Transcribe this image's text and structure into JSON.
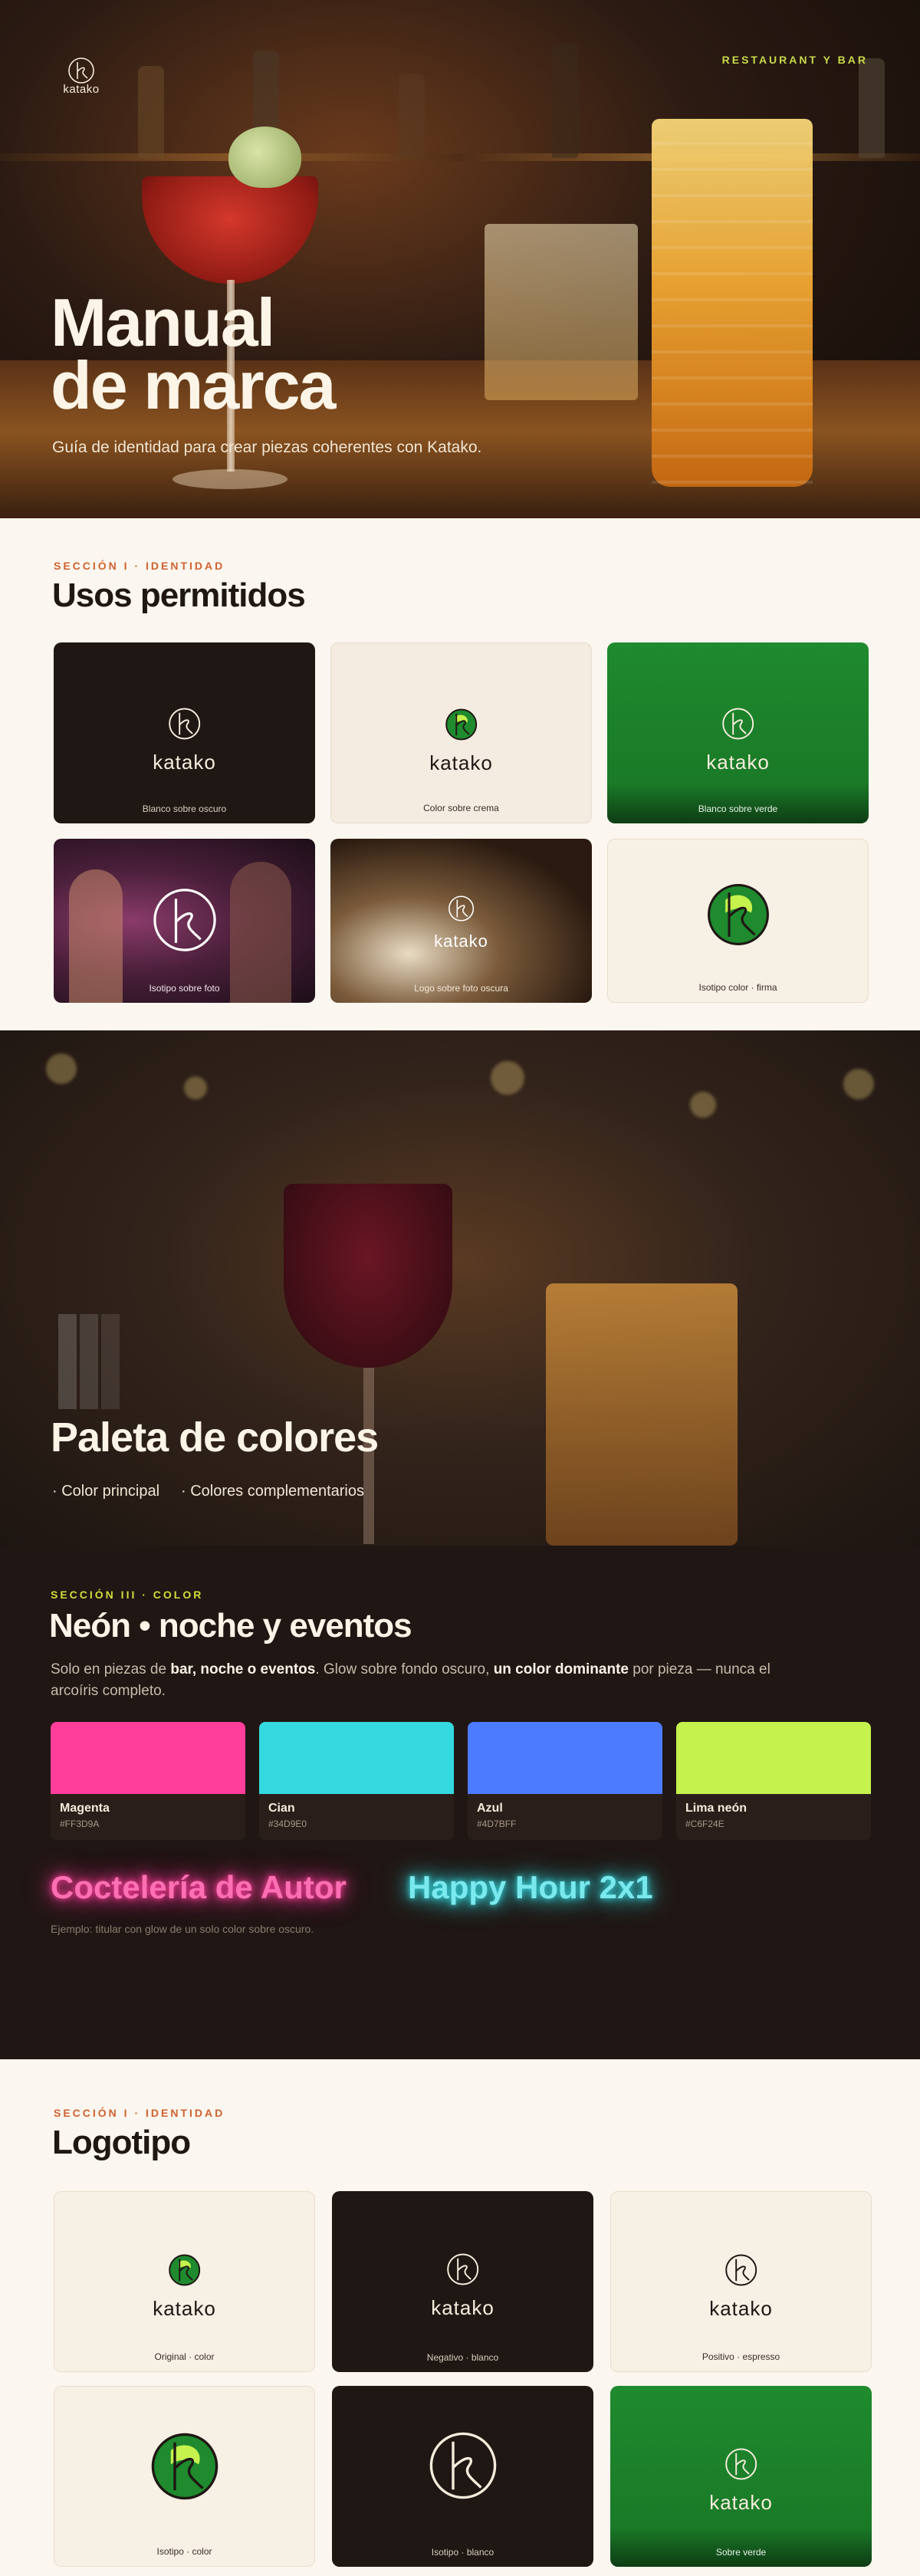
{
  "hero": {
    "brand": "katako",
    "tagline": "RESTAURANT Y BAR",
    "title_line1": "Manual",
    "title_line2": "de marca",
    "subtitle": "Guía de identidad para crear piezas coherentes con Katako."
  },
  "usos": {
    "eyebrow": "SECCIÓN I · IDENTIDAD",
    "title": "Usos permitidos",
    "cards": [
      {
        "caption": "Blanco sobre oscuro",
        "word": "katako"
      },
      {
        "caption": "Color sobre crema",
        "word": "katako"
      },
      {
        "caption": "Blanco sobre verde",
        "word": "katako"
      },
      {
        "caption": "Isotipo sobre foto"
      },
      {
        "caption": "Logo sobre foto oscura",
        "word": "katako"
      },
      {
        "caption": "Isotipo color · firma"
      }
    ]
  },
  "paleta": {
    "title": "Paleta de colores",
    "items": [
      "Color principal",
      "Colores complementarios"
    ]
  },
  "neon": {
    "eyebrow": "SECCIÓN III · COLOR",
    "title": "Neón • noche y eventos",
    "desc_pre": "Solo en piezas de ",
    "desc_bold1": "bar, noche o eventos",
    "desc_mid": ". Glow sobre fondo oscuro, ",
    "desc_bold2": "un color dominante",
    "desc_post": " por pieza — nunca el arcoíris completo.",
    "swatches": [
      {
        "name": "Magenta",
        "hex": "#FF3D9A",
        "color": "#FF3D9A"
      },
      {
        "name": "Cian",
        "hex": "#34D9E0",
        "color": "#34D9E0"
      },
      {
        "name": "Azul",
        "hex": "#4D7BFF",
        "color": "#4D7BFF"
      },
      {
        "name": "Lima neón",
        "hex": "#C6F24E",
        "color": "#C6F24E"
      }
    ],
    "sample1": "Coctelería de Autor",
    "sample2": "Happy Hour 2x1",
    "example": "Ejemplo: titular con glow de un solo color sobre oscuro."
  },
  "logotipo": {
    "eyebrow": "SECCIÓN I · IDENTIDAD",
    "title": "Logotipo",
    "cards": [
      {
        "caption": "Original · color",
        "word": "katako"
      },
      {
        "caption": "Negativo · blanco",
        "word": "katako"
      },
      {
        "caption": "Positivo · espresso",
        "word": "katako"
      },
      {
        "caption": "Isotipo · color"
      },
      {
        "caption": "Isotipo · blanco"
      },
      {
        "caption": "Sobre verde",
        "word": "katako"
      }
    ]
  },
  "colors": {
    "espresso": "#1F1714",
    "cream": "#F4ECE0",
    "green": "#1F8A2E",
    "accent_orange": "#D0622F",
    "lime_label": "#C9D94A"
  }
}
